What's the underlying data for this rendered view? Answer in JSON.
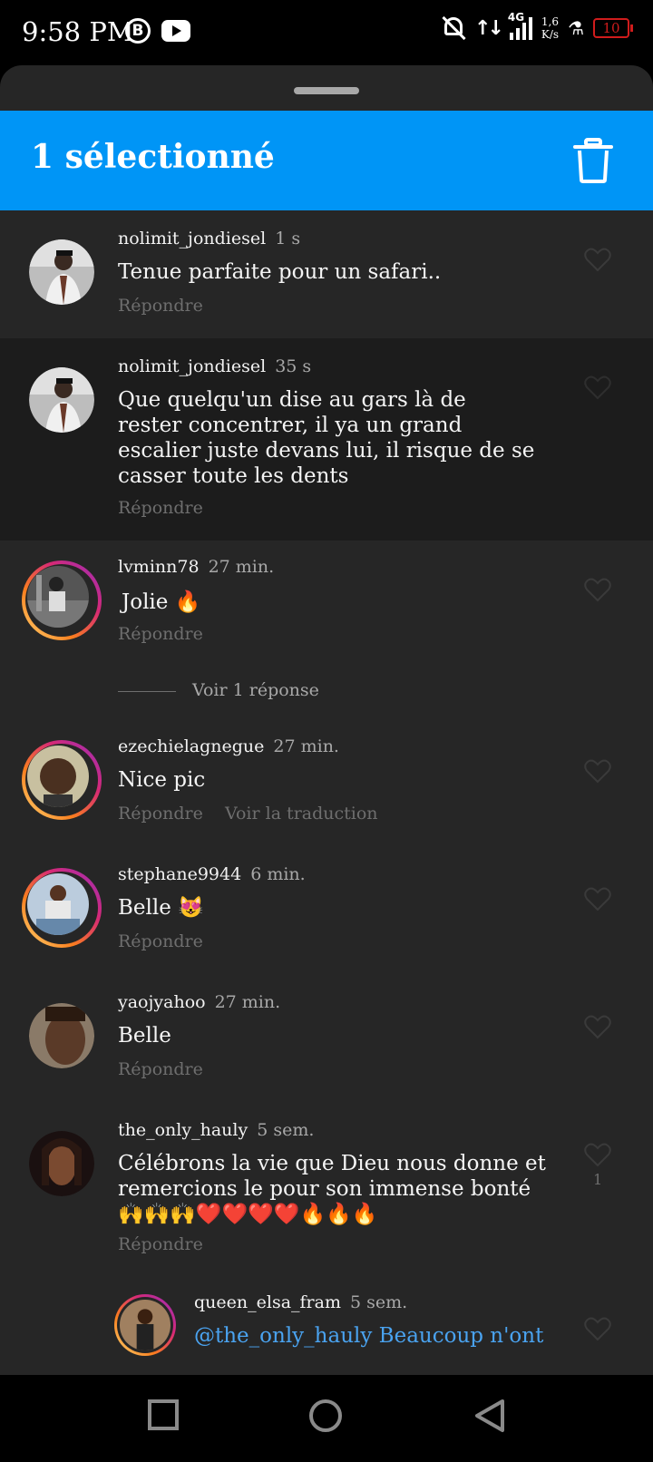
{
  "status_bar": {
    "time": "9:58 PM",
    "network": "4G",
    "speed_value": "1,6",
    "speed_unit": "K/s",
    "battery": "10",
    "icons": [
      "b-icon",
      "youtube-icon",
      "mute-icon",
      "data-transfer-icon",
      "signal-icon",
      "flask-icon",
      "battery-icon"
    ],
    "battery_color": "#d01c1c"
  },
  "selection_bar": {
    "title": "1 sélectionné",
    "accent": "#0095f6",
    "action_icon": "trash-icon"
  },
  "comments": [
    {
      "username": "nolimit_jondiesel",
      "time": "1 s",
      "text": "Tenue parfaite pour un safari..",
      "reply": "Répondre",
      "selected": false,
      "story_ring": false
    },
    {
      "username": "nolimit_jondiesel",
      "time": "35 s",
      "text": "Que quelqu'un dise au gars là de rester concentrer, il ya un grand escalier juste devans lui, il risque de se casser toute les dents",
      "reply": "Répondre",
      "selected": true,
      "story_ring": false
    },
    {
      "username": "lvminn78",
      "time": "27 min.",
      "text": "Jolie 🔥",
      "reply": "Répondre",
      "view_replies": "Voir 1 réponse",
      "story_ring": true
    },
    {
      "username": "ezechielagnegue",
      "time": "27 min.",
      "text": "Nice pic",
      "reply": "Répondre",
      "translate": "Voir la traduction",
      "story_ring": true
    },
    {
      "username": "stephane9944",
      "time": "6 min.",
      "text": "Belle 😻",
      "reply": "Répondre",
      "story_ring": true
    },
    {
      "username": "yaojyahoo",
      "time": "27 min.",
      "text": "Belle",
      "reply": "Répondre",
      "story_ring": false
    },
    {
      "username": "the_only_hauly",
      "time": "5 sem.",
      "text": "Célébrons la vie que Dieu nous donne et remercions le pour son immense bonté 🙌🙌🙌❤️❤️❤️❤️🔥🔥🔥",
      "reply": "Répondre",
      "likes": "1",
      "story_ring": false
    },
    {
      "username": "queen_elsa_fram",
      "time": "5 sem.",
      "text": "@the_only_hauly Beaucoup n'ont",
      "story_ring": true
    }
  ],
  "nav_bar": {
    "buttons": [
      "recents-square-icon",
      "home-circle-icon",
      "back-triangle-icon"
    ]
  }
}
